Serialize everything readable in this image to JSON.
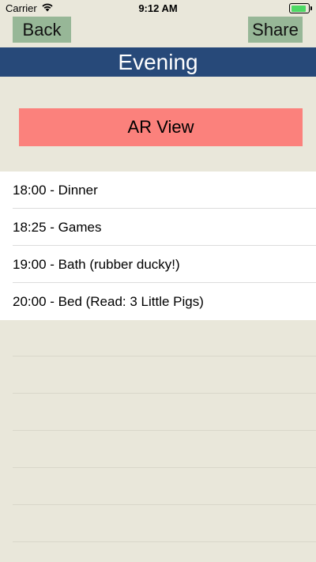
{
  "status_bar": {
    "carrier": "Carrier",
    "time": "9:12 AM",
    "battery_level": 0.9,
    "icons": [
      "wifi-icon",
      "battery-icon"
    ]
  },
  "nav": {
    "back_label": "Back",
    "share_label": "Share"
  },
  "title": "Evening",
  "ar_button_label": "AR View",
  "schedule": [
    "18:00 - Dinner",
    "18:25 - Games",
    "19:00 - Bath (rubber ducky!)",
    "20:00 - Bed (Read: 3 Little Pigs)"
  ],
  "colors": {
    "background": "#e9e7da",
    "nav_button": "#97b797",
    "title_bar": "#274979",
    "ar_button": "#fb817c",
    "battery": "#4cd964"
  }
}
